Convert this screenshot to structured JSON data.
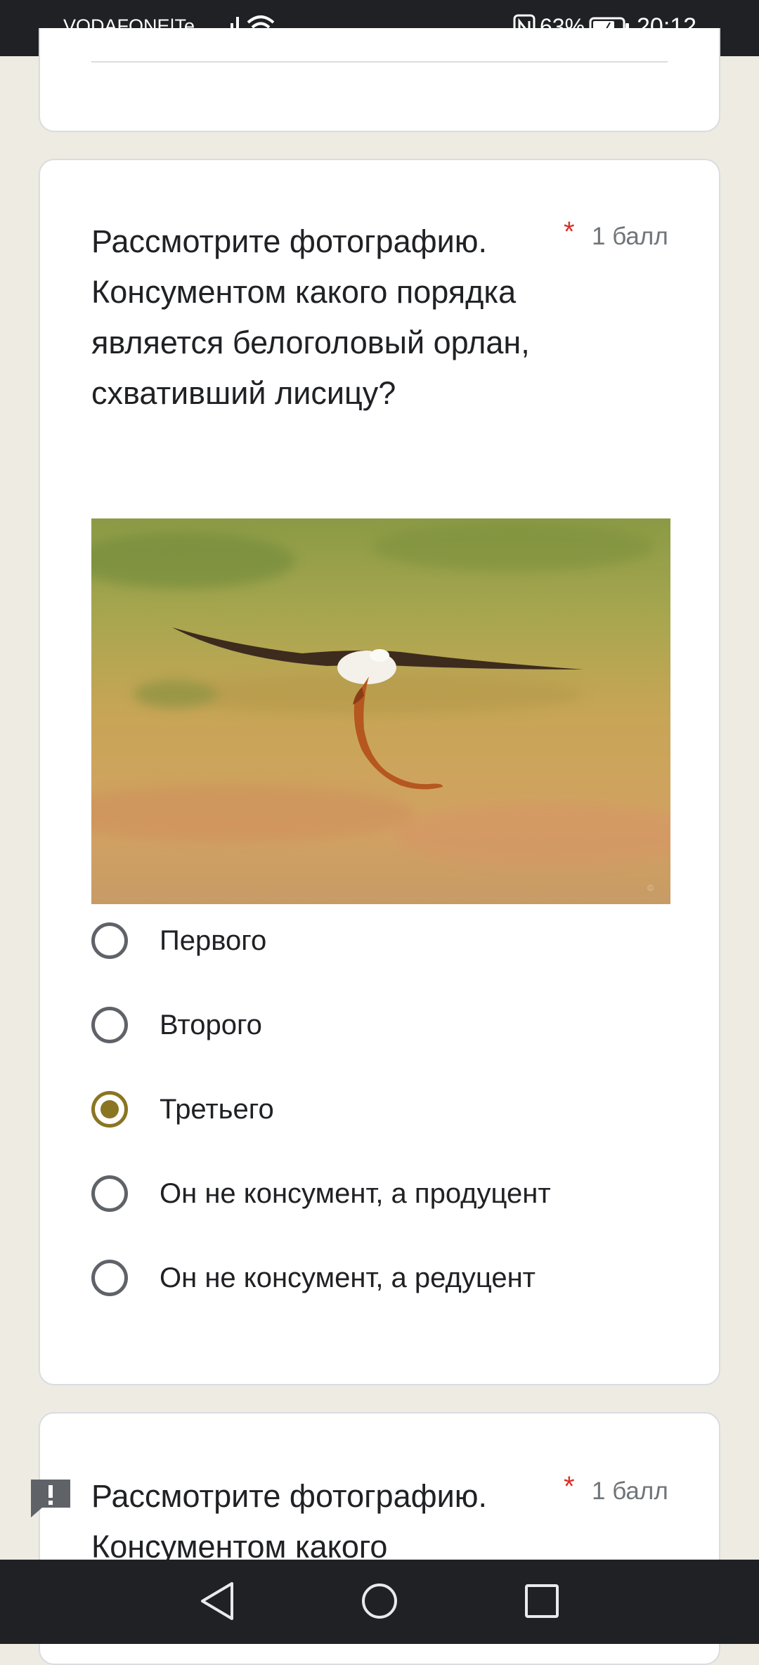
{
  "status_bar": {
    "carrier": "VODAFONE|Te...",
    "battery_pct": "63%",
    "time": "20:12"
  },
  "question1": {
    "title": "Рассмотрите фотографию. Консументом какого порядка является белоголовый орлан, схвативший лисицу?",
    "required_mark": "*",
    "points": "1 балл",
    "options": [
      {
        "label": "Первого",
        "selected": false
      },
      {
        "label": "Второго",
        "selected": false
      },
      {
        "label": "Третьего",
        "selected": true
      },
      {
        "label": "Он не консумент, а продуцент",
        "selected": false
      },
      {
        "label": "Он не консумент, а редуцент",
        "selected": false
      }
    ]
  },
  "question2": {
    "title": "Рассмотрите фотографию. Консументом какого",
    "required_mark": "*",
    "points": "1 балл"
  },
  "icons": {
    "feedback": "report-feedback-icon",
    "nav_back": "back-triangle-icon",
    "nav_home": "home-circle-icon",
    "nav_recents": "recents-square-icon"
  },
  "colors": {
    "accent": "#8a7522",
    "required": "#d93025",
    "background": "#edebe2"
  }
}
